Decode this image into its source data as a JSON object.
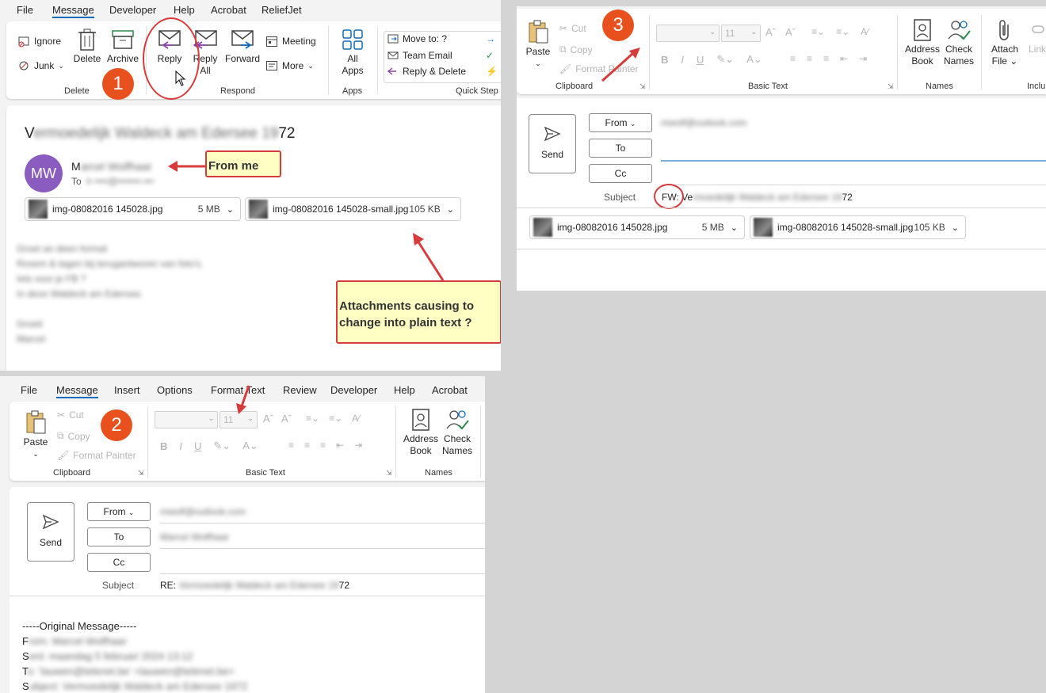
{
  "panel1": {
    "menu": [
      "File",
      "Message",
      "Developer",
      "Help",
      "Acrobat",
      "ReliefJet"
    ],
    "active_menu": "Message",
    "delete_group": {
      "ignore": "Ignore",
      "junk": "Junk",
      "delete": "Delete",
      "archive": "Archive",
      "label": "Delete"
    },
    "respond_group": {
      "reply": "Reply",
      "reply_all_1": "Reply",
      "reply_all_2": "All",
      "forward": "Forward",
      "meeting": "Meeting",
      "more": "More",
      "label": "Respond"
    },
    "apps_group": {
      "all_apps_1": "All",
      "all_apps_2": "Apps",
      "label": "Apps"
    },
    "quick_steps": {
      "move_to": "Move to: ?",
      "team_email": "Team Email",
      "reply_delete": "Reply & Delete",
      "label": "Quick Step"
    },
    "email": {
      "subject_prefix": "V",
      "subject_blur": "ermoedelijk Waldeck am Edersee 19",
      "subject_suffix": "72",
      "avatar": "MW",
      "sender_initial": "M",
      "sender_blur": "arcel Wolfhaar",
      "to_label": "To",
      "to_blur": "l• ••••@•••••••.•••"
    },
    "attachments": [
      {
        "name": "img-08082016 145028.jpg",
        "size": "5 MB"
      },
      {
        "name": "img-08082016 145028-small.jpg",
        "size": "105 KB"
      }
    ],
    "body_blur": [
      "Groet an deen format",
      "Rosem & tagen bij terugantworen van foto's.",
      "Iets voor je FB ?",
      "In deze Waldeck am Edersee.",
      "",
      "Groeti",
      "Marcel"
    ],
    "annotation_from": "From me",
    "annotation_attach": "Attachments causing to change into plain text ?",
    "badge": "1"
  },
  "panel2": {
    "menu": [
      "File",
      "Message",
      "Insert",
      "Options",
      "Format Text",
      "Review",
      "Developer",
      "Help",
      "Acrobat"
    ],
    "active_menu": "Message",
    "clipboard": {
      "paste": "Paste",
      "cut": "Cut",
      "copy": "Copy",
      "format_painter": "Format Painter",
      "label": "Clipboard"
    },
    "basic_text": {
      "font_size": "11",
      "label": "Basic Text"
    },
    "names": {
      "address_1": "Address",
      "address_2": "Book",
      "check_1": "Check",
      "check_2": "Names",
      "label": "Names"
    },
    "compose": {
      "send": "Send",
      "from": "From",
      "to": "To",
      "cc": "Cc",
      "subject_label": "Subject",
      "subject_prefix": "RE: ",
      "subject_blur": "Vermoedelijk Waldeck am Edersee 19",
      "subject_suffix": "72",
      "from_blur": "mwolf@outlook.com",
      "to_blur": "Marcel Wolfhaar"
    },
    "original_header": "-----Original Message-----",
    "original_lines": [
      {
        "first": "F",
        "rest": "rom: Marcel Wolfhaar"
      },
      {
        "first": "S",
        "rest": "ent: maandag 5 februari 2024 13:12"
      },
      {
        "first": "T",
        "rest": "o: 'lauwen@telenet.be' <lauwen@telenet.be>"
      },
      {
        "first": "S",
        "rest": "ubject: Vermoedelijk Waldeck am Edersee 1972"
      }
    ],
    "badge": "2"
  },
  "panel3": {
    "clipboard": {
      "paste": "Paste",
      "cut": "Cut",
      "copy": "Copy",
      "format_painter": "Format Painter",
      "label": "Clipboard"
    },
    "basic_text": {
      "font_size": "11",
      "label": "Basic Text"
    },
    "names": {
      "address_1": "Address",
      "address_2": "Book",
      "check_1": "Check",
      "check_2": "Names",
      "label": "Names"
    },
    "include": {
      "attach_1": "Attach",
      "attach_2": "File",
      "link": "Link",
      "label": "Inclu"
    },
    "compose": {
      "send": "Send",
      "from": "From",
      "to": "To",
      "cc": "Cc",
      "subject_label": "Subject",
      "subject_prefix": "FW: Ve",
      "subject_blur": "rmoedelijk Waldeck am Edersee 19",
      "subject_suffix": "72",
      "from_blur": "mwolf@outlook.com"
    },
    "attachments": [
      {
        "name": "img-08082016 145028.jpg",
        "size": "5 MB"
      },
      {
        "name": "img-08082016 145028-small.jpg",
        "size": "105 KB"
      }
    ],
    "badge": "3"
  },
  "colors": {
    "accent": "#0f6cbd",
    "badge": "#e8501e",
    "note_bg": "#ffffc4",
    "note_border": "#d63c3c",
    "avatar": "#8a5cc0"
  }
}
